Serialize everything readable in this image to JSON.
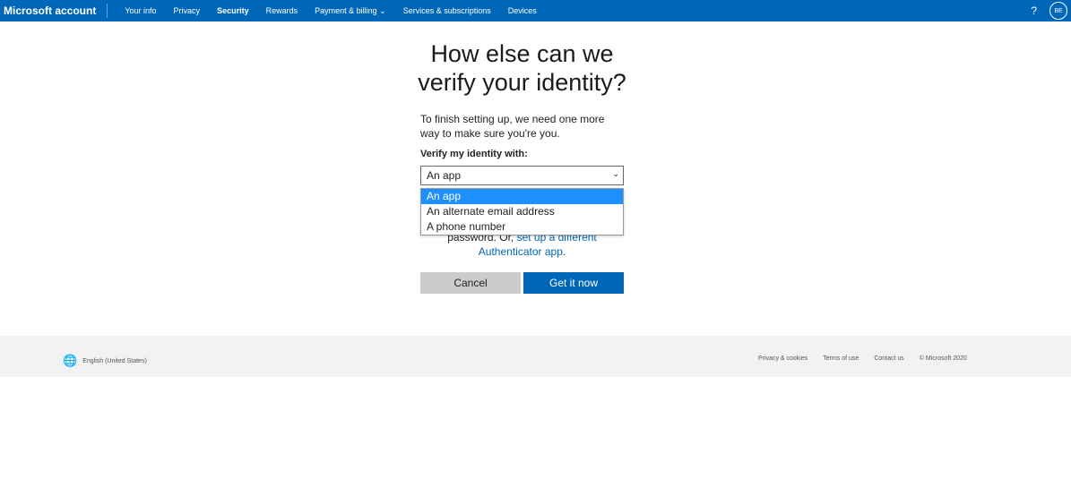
{
  "nav": {
    "brand": "Microsoft account",
    "items": [
      "Your info",
      "Privacy",
      "Security",
      "Rewards",
      "Payment & billing",
      "Services & subscriptions",
      "Devices"
    ],
    "active": "Security",
    "help": "?",
    "avatar": "BE"
  },
  "main": {
    "title": "How else can we verify your identity?",
    "description": "To finish setting up, we need one more way to make sure you're you.",
    "label": "Verify my identity with:",
    "selected": "An app",
    "options": [
      "An app",
      "An alternate email address",
      "A phone number"
    ],
    "hint_text": "password. Or,",
    "hint_link": "set up a different Authenticator app.",
    "cancel": "Cancel",
    "submit": "Get it now"
  },
  "footer": {
    "language": "English (United States)",
    "links": [
      "Privacy & cookies",
      "Terms of use",
      "Contact us",
      "© Microsoft 2020"
    ]
  },
  "colors": {
    "brand": "#0067b8",
    "highlight": "#1e90ff"
  }
}
